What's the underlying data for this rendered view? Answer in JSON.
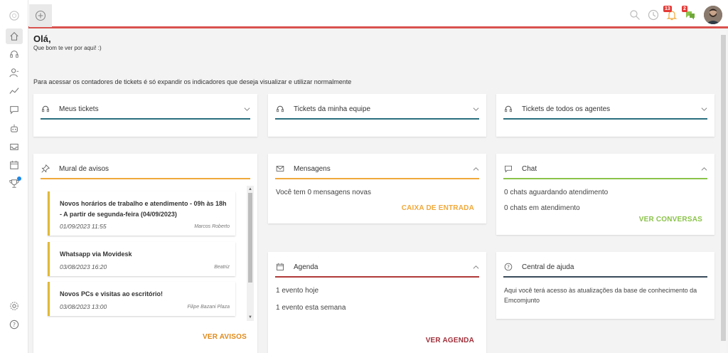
{
  "colors": {
    "topbar_accent": "#d9534f",
    "teal": "#2a6f7f",
    "orange": "#f0a93b",
    "green": "#8bc34a",
    "red_line": "#b03a3a",
    "dark_line": "#3a4a5a",
    "ver_avisos": "#e08a1a",
    "caixa": "#f0a93b",
    "ver_conversas": "#8bc34a",
    "ver_agenda": "#a0303a"
  },
  "topbar": {
    "notif_count": "13",
    "chat_count": "2"
  },
  "greeting": {
    "title": "Olá,",
    "subtitle": "Que bom te ver por aqui! :)"
  },
  "hint": "Para acessar os contadores de tickets é só expandir os indicadores que deseja visualizar e utilizar normalmente",
  "tickets": [
    {
      "title": "Meus tickets"
    },
    {
      "title": "Tickets da minha equipe"
    },
    {
      "title": "Tickets de todos os agentes"
    }
  ],
  "mural": {
    "title": "Mural de avisos",
    "action": "VER AVISOS",
    "notices": [
      {
        "title": "Novos horários de trabalho e atendimento - 09h às 18h - A partir de segunda-feira (04/09/2023)",
        "date": "01/09/2023 11:55",
        "author": "Marcos Roberto"
      },
      {
        "title": "Whatsapp via Movidesk",
        "date": "03/08/2023 16:20",
        "author": "Beatriz"
      },
      {
        "title": "Novos PCs e visitas ao escritório!",
        "date": "03/08/2023 13:00",
        "author": "Filipe Bazani Plaza"
      }
    ]
  },
  "mensagens": {
    "title": "Mensagens",
    "text": "Você tem 0 mensagens novas",
    "action": "CAIXA DE ENTRADA"
  },
  "chat": {
    "title": "Chat",
    "waiting": "0 chats aguardando atendimento",
    "ongoing": "0 chats em atendimento",
    "action": "VER CONVERSAS"
  },
  "agenda": {
    "title": "Agenda",
    "today": "1 evento hoje",
    "week": "1 evento esta semana",
    "action": "VER AGENDA"
  },
  "ajuda": {
    "title": "Central de ajuda",
    "text": "Aqui você terá acesso às atualizações da base de conhecimento da Emcomjunto"
  }
}
